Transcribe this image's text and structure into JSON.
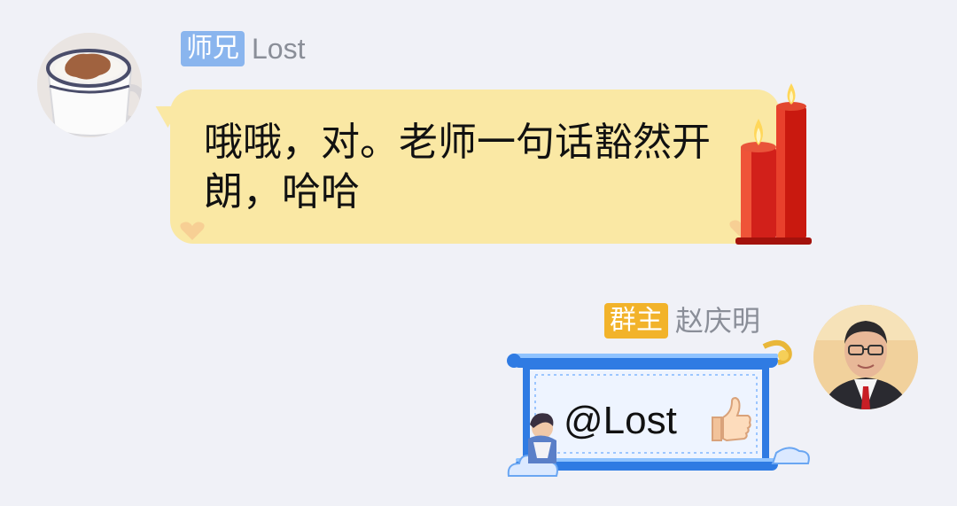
{
  "messages": [
    {
      "badge": "师兄",
      "sender": "Lost",
      "text": "哦哦，对。老师一句话豁然开朗，哈哈",
      "avatar_icon": "coffee-cup-avatar",
      "bubble_color": "#fae8a4"
    },
    {
      "badge": "群主",
      "sender": "赵庆明",
      "text": "@Lost",
      "emoji_icon": "thumbs-up-icon",
      "avatar_icon": "person-avatar",
      "bubble_style": "scroll"
    }
  ],
  "colors": {
    "background": "#f0f1f7",
    "badge_blue": "#8ab5ee",
    "badge_gold": "#f2b32a",
    "name_gray": "#8a8e98"
  }
}
